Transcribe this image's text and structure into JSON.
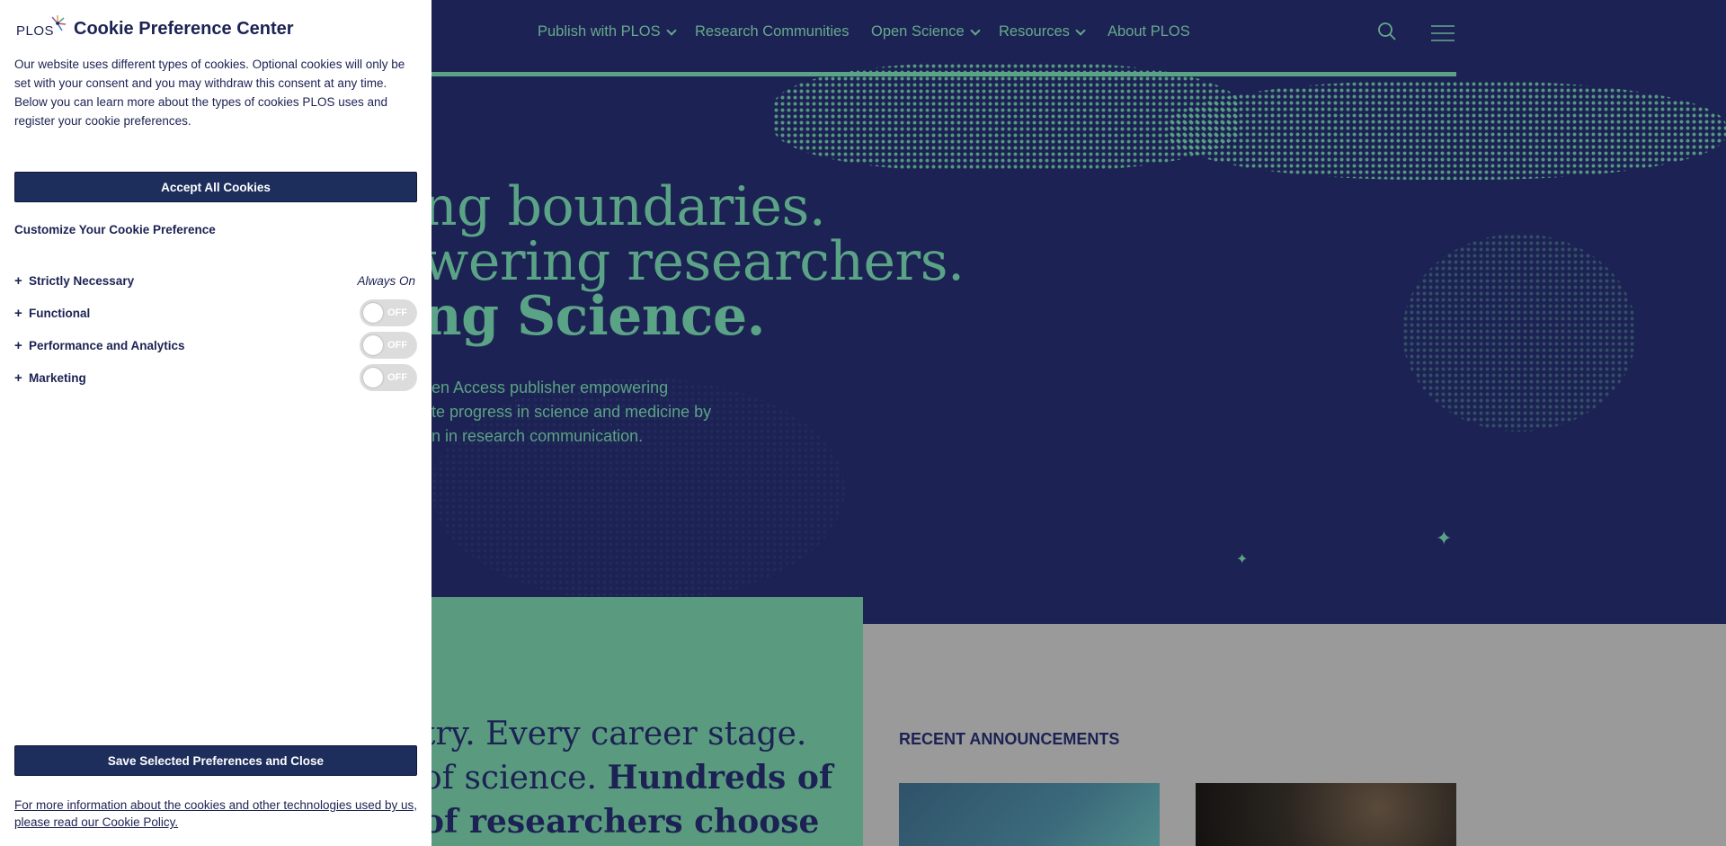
{
  "site": {
    "nav": {
      "items": [
        {
          "label": "Publish with PLOS",
          "has_dropdown": true
        },
        {
          "label": "Research Communities",
          "has_dropdown": false
        },
        {
          "label": "Open Science",
          "has_dropdown": true
        },
        {
          "label": "Resources",
          "has_dropdown": true
        },
        {
          "label": "About PLOS",
          "has_dropdown": false
        }
      ],
      "search_icon": "search-icon",
      "menu_icon": "hamburger-menu-icon"
    },
    "hero": {
      "line1": "ng boundaries.",
      "line2": "wering researchers.",
      "line3": "ng Science.",
      "sub1": "pen Access publisher empowering",
      "sub2": "ate progress in science and medicine by",
      "sub3": "on in research communication."
    },
    "band": {
      "line1": "try. Every career stage.",
      "line2a": "of science. ",
      "line2b": "Hundreds of",
      "line3": "of researchers choose"
    },
    "announcements_title": "RECENT ANNOUNCEMENTS"
  },
  "cookie": {
    "logo_text": "PLOS",
    "title": "Cookie Preference Center",
    "description": "Our website uses different types of cookies. Optional cookies will only be set with your consent and you may withdraw this consent at any time. Below you can learn more about the types of cookies PLOS uses and register your cookie preferences.",
    "accept_all": "Accept All Cookies",
    "customize_heading": "Customize Your Cookie Preference",
    "categories": [
      {
        "label": "Strictly Necessary",
        "status": "Always On"
      },
      {
        "label": "Functional",
        "toggle": "OFF"
      },
      {
        "label": "Performance and Analytics",
        "toggle": "OFF"
      },
      {
        "label": "Marketing",
        "toggle": "OFF"
      }
    ],
    "save_button": "Save Selected Preferences and Close",
    "policy_link": "For more information about the cookies and other technologies used by us, please read our Cookie Policy.",
    "colors": {
      "primary": "#1e2e5c",
      "brand_green": "#5ba386",
      "hero_bg": "#1c2253"
    }
  }
}
